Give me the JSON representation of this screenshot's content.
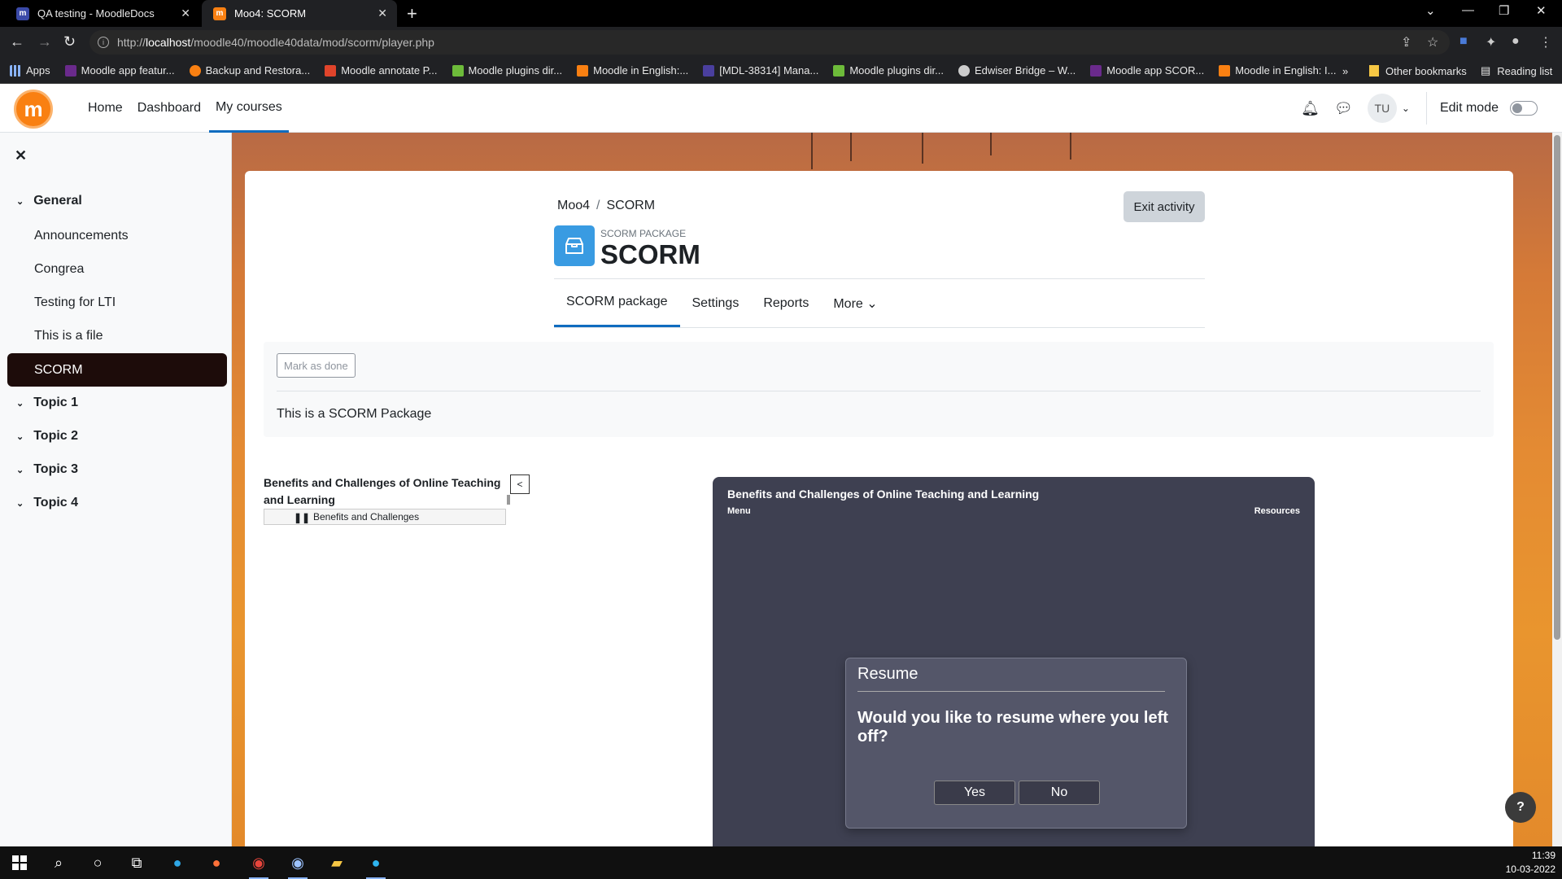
{
  "browser": {
    "tabs": [
      {
        "title": "QA testing - MoodleDocs",
        "active": false
      },
      {
        "title": "Moo4: SCORM",
        "active": true
      }
    ],
    "url_prefix": "http://",
    "url_host": "localhost",
    "url_path": "/moodle40/moodle40data/mod/scorm/player.php",
    "bookmarks": [
      {
        "label": "Apps",
        "color": "#8ab4f8"
      },
      {
        "label": "Moodle app featur...",
        "color": "#6a2a8c"
      },
      {
        "label": "Backup and Restora...",
        "color": "#f98012"
      },
      {
        "label": "Moodle annotate P...",
        "color": "#e0442b"
      },
      {
        "label": "Moodle plugins dir...",
        "color": "#6dbb3a"
      },
      {
        "label": "Moodle in English:...",
        "color": "#f98012"
      },
      {
        "label": "[MDL-38314] Mana...",
        "color": "#4a3f9e"
      },
      {
        "label": "Moodle plugins dir...",
        "color": "#6dbb3a"
      },
      {
        "label": "Edwiser Bridge – W...",
        "color": "#cccccc"
      },
      {
        "label": "Moodle app SCOR...",
        "color": "#6a2a8c"
      },
      {
        "label": "Moodle in English: I...",
        "color": "#f98012"
      }
    ],
    "other_bookmarks": "Other bookmarks",
    "reading_list": "Reading list",
    "more_bookmarks": "»"
  },
  "navbar": {
    "items": [
      {
        "label": "Home",
        "active": false
      },
      {
        "label": "Dashboard",
        "active": false
      },
      {
        "label": "My courses",
        "active": true
      }
    ],
    "user_initials": "TU",
    "edit_mode_label": "Edit mode"
  },
  "drawer": {
    "sections": [
      {
        "label": "General"
      },
      {
        "label": "Topic 1"
      },
      {
        "label": "Topic 2"
      },
      {
        "label": "Topic 3"
      },
      {
        "label": "Topic 4"
      }
    ],
    "general_items": [
      {
        "label": "Announcements"
      },
      {
        "label": "Congrea"
      },
      {
        "label": "Testing for LTI"
      },
      {
        "label": "This is a file"
      },
      {
        "label": "SCORM",
        "active": true
      }
    ]
  },
  "page": {
    "breadcrumb": [
      "Moo4",
      "SCORM"
    ],
    "exit_label": "Exit activity",
    "activity_type": "SCORM PACKAGE",
    "activity_title": "SCORM",
    "tabs": [
      {
        "label": "SCORM package",
        "active": true
      },
      {
        "label": "Settings"
      },
      {
        "label": "Reports"
      },
      {
        "label": "More ⌄"
      }
    ],
    "mark_done": "Mark as done",
    "description": "This is a SCORM Package"
  },
  "scorm": {
    "toc_title": "Benefits and Challenges of Online Teaching and Learning",
    "toc_toggle": "<",
    "toc_item": "Benefits and Challenges",
    "player_title": "Benefits and Challenges of Online Teaching and Learning",
    "menu_label": "Menu",
    "resources_label": "Resources",
    "dialog": {
      "title": "Resume",
      "question": "Would you like to resume where you left off?",
      "yes": "Yes",
      "no": "No"
    }
  },
  "help_label": "?",
  "taskbar": {
    "time": "11:39",
    "date": "10-03-2022"
  }
}
